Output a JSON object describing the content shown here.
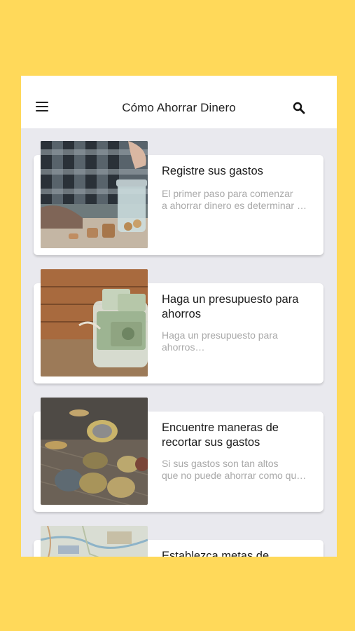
{
  "header": {
    "title": "Cómo Ahorrar Dinero"
  },
  "articles": [
    {
      "title": "Registre sus gastos",
      "desc_line1": "El primer paso para comenzar",
      "desc_line2": "a ahorrar dinero es determinar …"
    },
    {
      "title_line1": "Haga un presupuesto para",
      "title_line2": "ahorros",
      "desc_line1": "Haga un presupuesto para",
      "desc_line2": "ahorros…"
    },
    {
      "title_line1": "Encuentre maneras de",
      "title_line2": "recortar sus gastos",
      "desc_line1": "Si sus gastos son tan altos",
      "desc_line2": "que no puede ahorrar como qu…"
    },
    {
      "title_line1": "Establezca metas de"
    }
  ],
  "colors": {
    "background": "#FFD95A",
    "list_background": "#E9E9EE"
  }
}
